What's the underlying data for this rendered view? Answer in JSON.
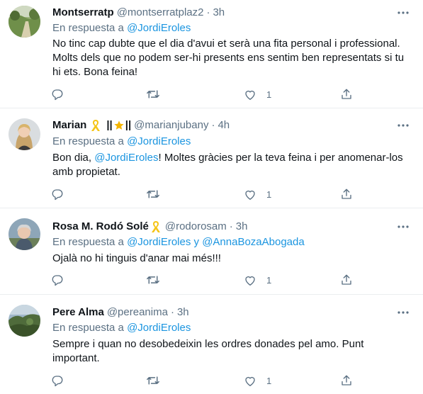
{
  "tweets": [
    {
      "name": "Montserratp",
      "handle": "@montserratplaz2",
      "dot": "·",
      "time": "3h",
      "reply_prefix": "En respuesta a",
      "reply_to": "@JordiEroles",
      "reply_and": "",
      "reply_to_2": "",
      "text": "No tinc cap dubte que el dia d'avui et serà una fita personal i professional. Molts dels que no podem ser-hi presents ens sentim ben representats si tu hi ets. Bona feina!",
      "likes": "1"
    },
    {
      "name": "Marian",
      "name_extra": "||",
      "name_extra_2": "||",
      "handle": "@marianjubany",
      "dot": "·",
      "time": "4h",
      "reply_prefix": "En respuesta a",
      "reply_to": "@JordiEroles",
      "text_before": "Bon dia, ",
      "text_mention": "@JordiEroles",
      "text_after": "! Moltes gràcies per la teva feina i per anomenar-los amb propietat.",
      "likes": "1"
    },
    {
      "name": "Rosa M. Rodó Solé",
      "handle": "@rodorosam",
      "dot": "·",
      "time": "3h",
      "reply_prefix": "En respuesta a",
      "reply_to": "@JordiEroles",
      "reply_and": "y",
      "reply_to_2": "@AnnaBozaAbogada",
      "text": "Ojalà no hi tinguis d'anar mai més!!!",
      "likes": "1"
    },
    {
      "name": "Pere Alma",
      "handle": "@pereanima",
      "dot": "·",
      "time": "3h",
      "reply_prefix": "En respuesta a",
      "reply_to": "@JordiEroles",
      "text": "Sempre i quan no desobedeixin les ordres donades pel amo. Punt important.",
      "likes": "1"
    }
  ],
  "icons": {
    "reply": "reply-icon",
    "retweet": "retweet-icon",
    "like": "like-icon",
    "share": "share-icon",
    "more": "more-icon",
    "ribbon": "yellow-ribbon-icon",
    "star": "star-icon"
  },
  "colors": {
    "text": "#0f1419",
    "secondary": "#5b7083",
    "link": "#1b95e0",
    "divider": "#ebeef0",
    "ribbon": "#f5c518"
  }
}
